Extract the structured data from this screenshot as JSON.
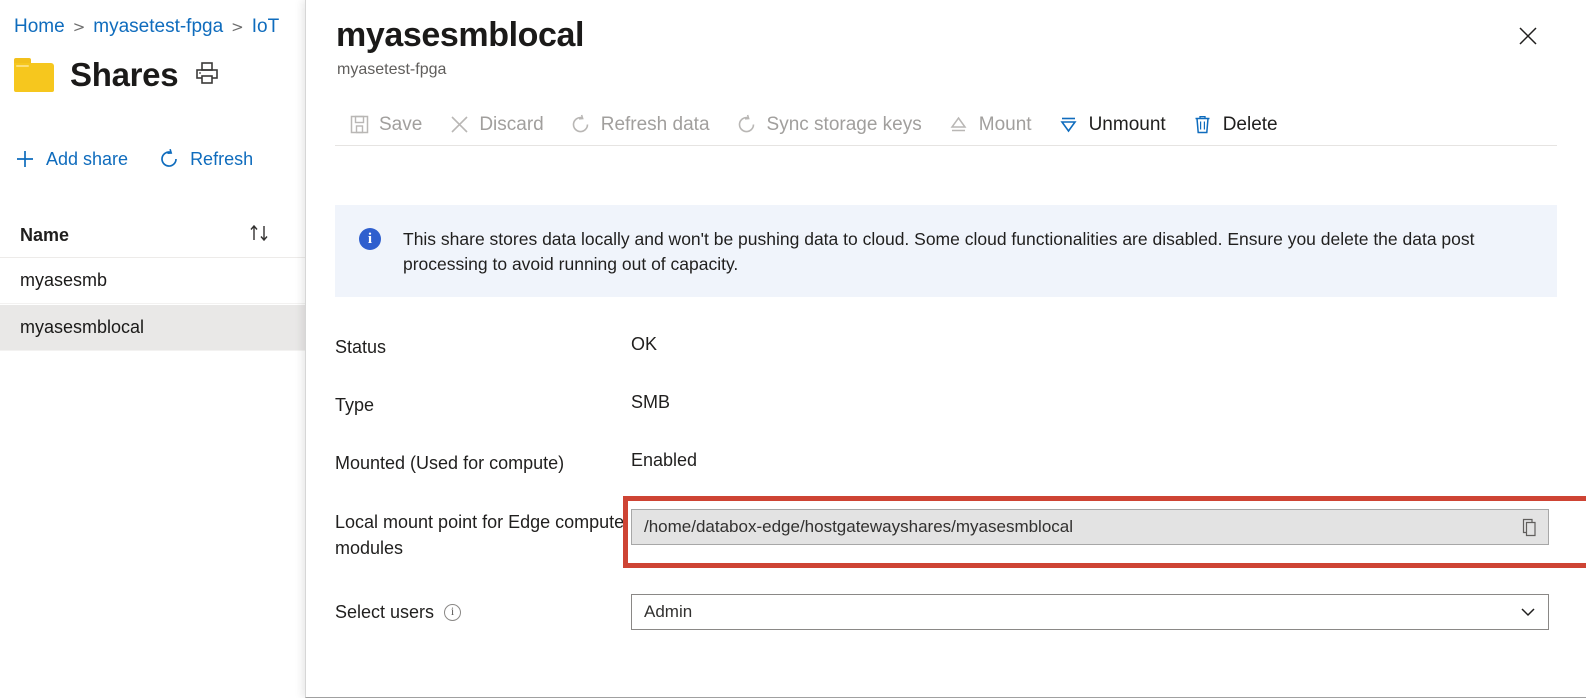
{
  "background": {
    "breadcrumb": [
      {
        "label": "Home",
        "type": "link"
      },
      {
        "label": ">",
        "type": "separator"
      },
      {
        "label": "myasetest-fpga",
        "type": "link"
      },
      {
        "label": ">",
        "type": "separator"
      },
      {
        "label": "IoT",
        "type": "link"
      }
    ],
    "page_title": "Shares",
    "print_icon": "printer-icon",
    "folder_icon": "folder-icon",
    "commands": [
      {
        "label": "Add share",
        "icon": "plus-icon"
      },
      {
        "label": "Refresh",
        "icon": "refresh-icon"
      }
    ],
    "list": {
      "column_header": "Name",
      "sort_icon": "sort-ascending-descending-icon",
      "rows": [
        {
          "name": "myasesmb",
          "selected": false
        },
        {
          "name": "myasesmblocal",
          "selected": true
        }
      ]
    }
  },
  "panel": {
    "title": "myasesmblocal",
    "subtitle": "myasetest-fpga",
    "close_icon": "close-icon",
    "commands": [
      {
        "label": "Save",
        "icon": "save-icon",
        "enabled": false
      },
      {
        "label": "Discard",
        "icon": "cancel-x-icon",
        "enabled": false
      },
      {
        "label": "Refresh data",
        "icon": "refresh-icon",
        "enabled": false
      },
      {
        "label": "Sync storage keys",
        "icon": "refresh-icon",
        "enabled": false
      },
      {
        "label": "Mount",
        "icon": "eject-up-icon",
        "enabled": false
      },
      {
        "label": "Unmount",
        "icon": "eject-down-icon",
        "enabled": true
      },
      {
        "label": "Delete",
        "icon": "trash-icon",
        "enabled": true
      }
    ],
    "info_banner": {
      "icon": "info-icon",
      "text": "This share stores data locally and won't be pushing data to cloud. Some cloud functionalities are disabled. Ensure you delete the data post processing to avoid running out of capacity.",
      "background_color": "#f0f4fb",
      "icon_color": "#2f5fce"
    },
    "fields": {
      "status": {
        "label": "Status",
        "value": "OK"
      },
      "type": {
        "label": "Type",
        "value": "SMB"
      },
      "mounted": {
        "label": "Mounted (Used for compute)",
        "value": "Enabled"
      },
      "mount_point": {
        "label": "Local mount point for Edge compute modules",
        "value": "/home/databox-edge/hostgatewayshares/myasesmblocal",
        "copy_icon": "copy-icon",
        "readonly": true
      },
      "select_users": {
        "label": "Select users",
        "info_icon": "info-circle-icon",
        "value": "Admin",
        "chevron_icon": "chevron-down-icon"
      }
    },
    "highlight_color": "#ce4434"
  }
}
